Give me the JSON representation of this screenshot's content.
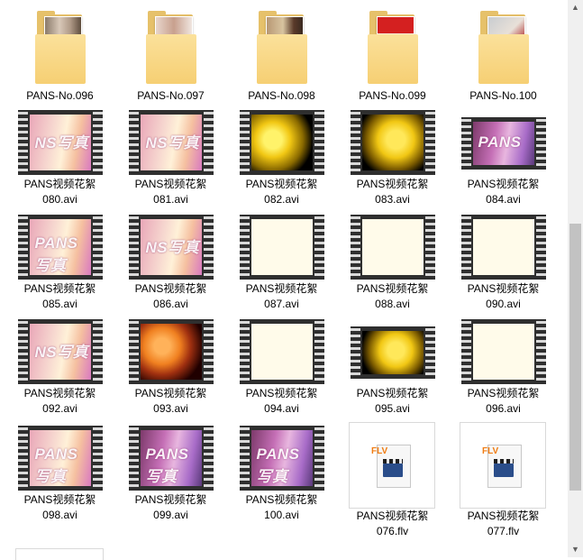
{
  "folders": [
    {
      "label": "PANS-No.096",
      "photo": "p1"
    },
    {
      "label": "PANS-No.097",
      "photo": "p2"
    },
    {
      "label": "PANS-No.098",
      "photo": "p3"
    },
    {
      "label": "PANS-No.099",
      "photo": "p4"
    },
    {
      "label": "PANS-No.100",
      "photo": "p5"
    }
  ],
  "videos": [
    [
      {
        "label": "PANS视频花絮\n080.avi",
        "thumb": "pink",
        "watermark": "NS写真"
      },
      {
        "label": "PANS视频花絮\n081.avi",
        "thumb": "pink",
        "watermark": "NS写真"
      },
      {
        "label": "PANS视频花絮\n082.avi",
        "thumb": "yellow",
        "watermark": ""
      },
      {
        "label": "PANS视频花絮\n083.avi",
        "thumb": "yellow2",
        "watermark": ""
      },
      {
        "label": "PANS视频花絮\n084.avi",
        "thumb": "purple",
        "watermark": "PANS"
      }
    ],
    [
      {
        "label": "PANS视频花絮\n085.avi",
        "thumb": "pink",
        "watermark": "PANS写真"
      },
      {
        "label": "PANS视频花絮\n086.avi",
        "thumb": "pink",
        "watermark": "NS写真"
      },
      {
        "label": "PANS视频花絮\n087.avi",
        "thumb": "cream",
        "watermark": ""
      },
      {
        "label": "PANS视频花絮\n088.avi",
        "thumb": "cream",
        "watermark": ""
      },
      {
        "label": "PANS视频花絮\n090.avi",
        "thumb": "cream",
        "watermark": ""
      }
    ],
    [
      {
        "label": "PANS视频花絮\n092.avi",
        "thumb": "pink",
        "watermark": "NS写真"
      },
      {
        "label": "PANS视频花絮\n093.avi",
        "thumb": "orange",
        "watermark": ""
      },
      {
        "label": "PANS视频花絮\n094.avi",
        "thumb": "cream",
        "watermark": ""
      },
      {
        "label": "PANS视频花絮\n095.avi",
        "thumb": "yellow2",
        "watermark": ""
      },
      {
        "label": "PANS视频花絮\n096.avi",
        "thumb": "cream",
        "watermark": ""
      }
    ],
    [
      {
        "label": "PANS视频花絮\n098.avi",
        "thumb": "pink",
        "watermark": "PANS写真"
      },
      {
        "label": "PANS视频花絮\n099.avi",
        "thumb": "purple",
        "watermark": "PANS写真"
      },
      {
        "label": "PANS视频花絮\n100.avi",
        "thumb": "purple",
        "watermark": "PANS写真"
      }
    ]
  ],
  "flv_files": [
    {
      "label": "PANS视频花絮\n076.flv",
      "badge": "FLV"
    },
    {
      "label": "PANS视频花絮\n077.flv",
      "badge": "FLV"
    }
  ],
  "scrollbar": {
    "up": "▲",
    "down": "▼"
  }
}
